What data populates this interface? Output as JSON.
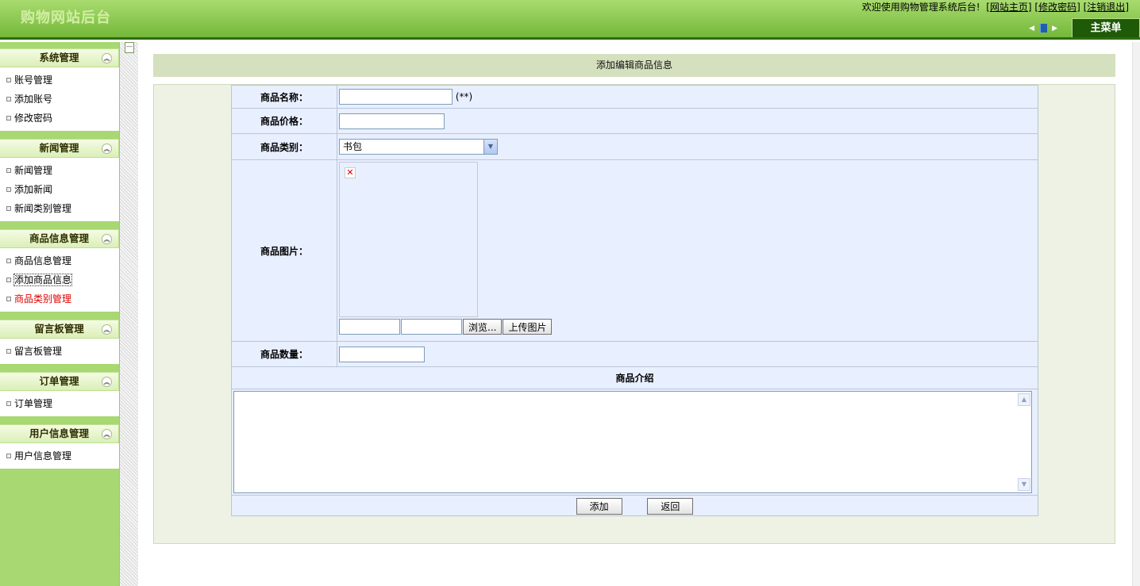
{
  "header": {
    "logo_text": "购物网站后台",
    "welcome_text": "欢迎使用购物管理系统后台!",
    "links": [
      "网站主页",
      "修改密码",
      "注销退出"
    ],
    "main_menu_tab": "主菜单"
  },
  "sidebar": {
    "groups": [
      {
        "title": "系统管理",
        "items": [
          "账号管理",
          "添加账号",
          "修改密码"
        ]
      },
      {
        "title": "新闻管理",
        "items": [
          "新闻管理",
          "添加新闻",
          "新闻类别管理"
        ]
      },
      {
        "title": "商品信息管理",
        "items": [
          "商品信息管理",
          "添加商品信息",
          "商品类别管理"
        ]
      },
      {
        "title": "留言板管理",
        "items": [
          "留言板管理"
        ]
      },
      {
        "title": "订单管理",
        "items": [
          "订单管理"
        ]
      },
      {
        "title": "用户信息管理",
        "items": [
          "用户信息管理"
        ]
      }
    ]
  },
  "form": {
    "title": "添加编辑商品信息",
    "name_label": "商品名称：",
    "name_value": "",
    "name_hint": "(**)",
    "price_label": "商品价格：",
    "price_value": "",
    "category_label": "商品类别：",
    "category_selected": "书包",
    "image_label": "商品图片：",
    "browse_button": "浏览...",
    "upload_button": "上传图片",
    "quantity_label": "商品数量：",
    "quantity_value": "",
    "intro_header": "商品介绍",
    "intro_value": "",
    "add_button": "添加",
    "back_button": "返回"
  },
  "colors": {
    "header_green": "#74b83a",
    "sidebar_green": "#a7d871",
    "form_blue": "#e8efff",
    "title_bar": "#d5e0bf",
    "active_menu": "#e00000"
  }
}
